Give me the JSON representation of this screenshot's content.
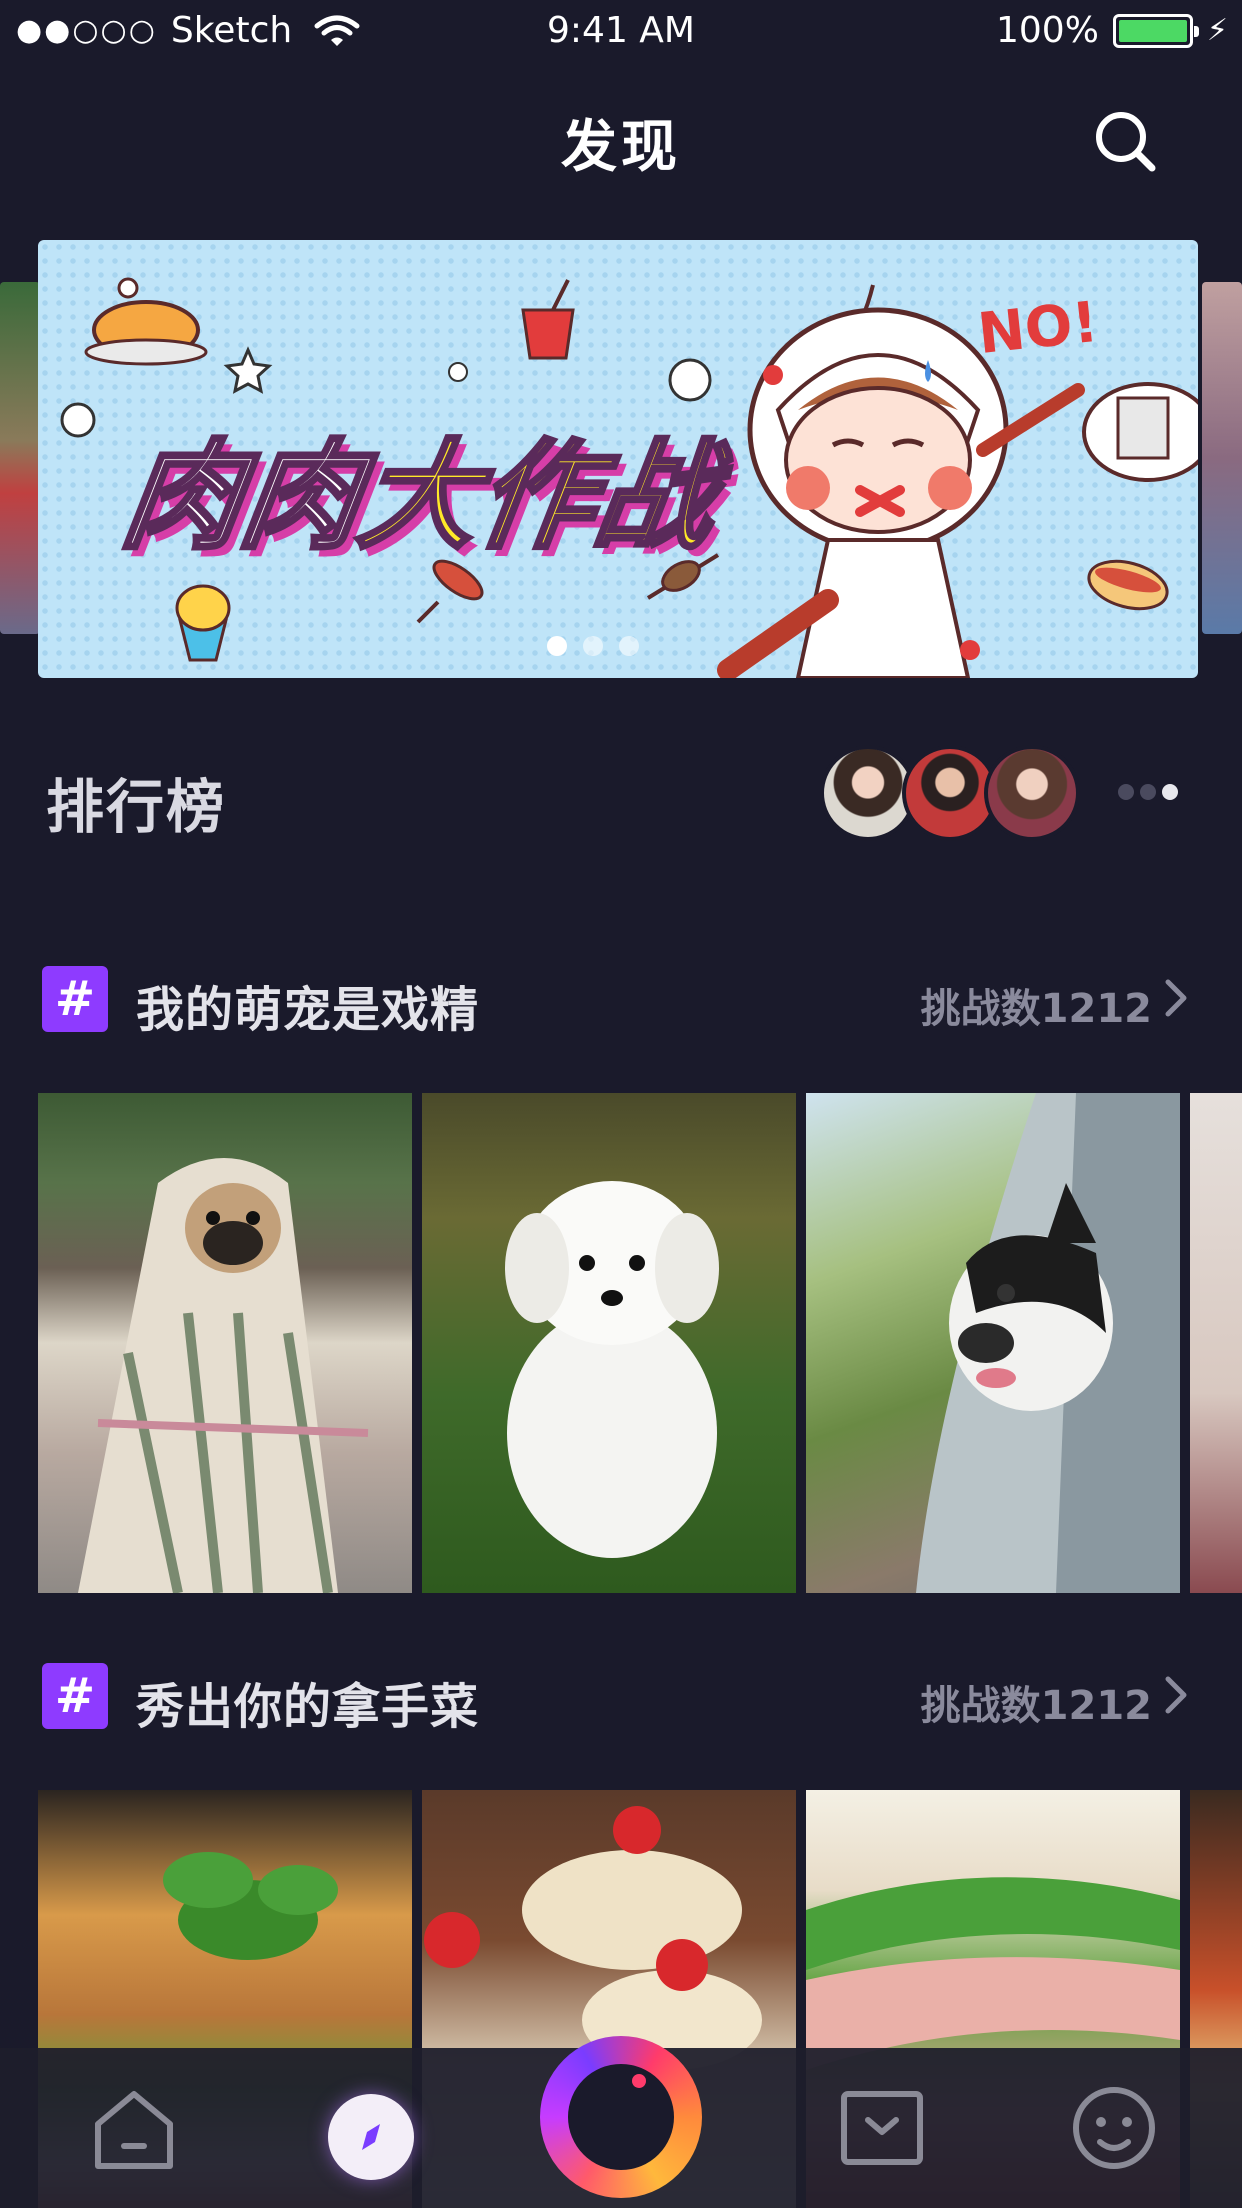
{
  "status_bar": {
    "signal": "●●○○○",
    "carrier": "Sketch",
    "time": "9:41 AM",
    "battery_text": "100%",
    "battery_color": "#4cd964"
  },
  "header": {
    "title": "发现",
    "search_icon": "search-icon"
  },
  "banner": {
    "title_white": "肉肉",
    "title_yellow": "大作战",
    "sticker_text": "NO!",
    "page_count": 3,
    "active_page": 1
  },
  "leaderboard": {
    "title": "排行榜",
    "avatars": [
      "avatar-1",
      "avatar-2",
      "avatar-3"
    ]
  },
  "topics": [
    {
      "title": "我的萌宠是戏精",
      "count_label": "挑战数1212",
      "thumbs": [
        "pug-in-blanket",
        "white-puppy-on-grass",
        "bulldog-in-car-window",
        "partial-fourth-photo"
      ]
    },
    {
      "title": "秀出你的拿手菜",
      "count_label": "挑战数1212",
      "thumbs": [
        "burger-with-basil",
        "strawberry-cream-puffs",
        "sandwich-with-ham",
        "pizza"
      ]
    }
  ],
  "tab_bar": {
    "items": [
      "home-icon",
      "discover-icon",
      "record-icon",
      "inbox-icon",
      "profile-face-icon"
    ],
    "accent_color": "#8e3bff"
  }
}
